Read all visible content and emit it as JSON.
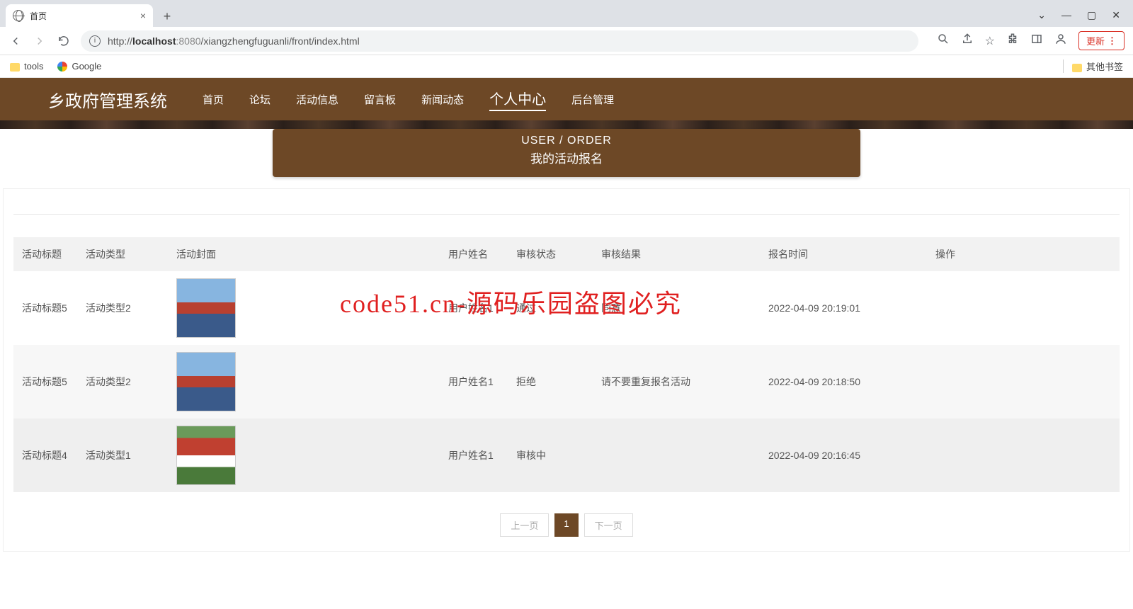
{
  "browser": {
    "tab_title": "首页",
    "url_prefix": "http://",
    "url_host": "localhost",
    "url_port": ":8080",
    "url_path": "/xiangzhengfuguanli/front/index.html",
    "bookmarks": {
      "tools": "tools",
      "google": "Google",
      "other": "其他书签"
    },
    "update": "更新"
  },
  "nav": {
    "logo": "乡政府管理系统",
    "items": [
      "首页",
      "论坛",
      "活动信息",
      "留言板",
      "新闻动态",
      "个人中心",
      "后台管理"
    ]
  },
  "header": {
    "line1": "USER / ORDER",
    "line2": "我的活动报名"
  },
  "table": {
    "cols": [
      "活动标题",
      "活动类型",
      "活动封面",
      "用户姓名",
      "审核状态",
      "审核结果",
      "报名时间",
      "操作"
    ],
    "rows": [
      {
        "title": "活动标题5",
        "type": "活动类型2",
        "user": "用户姓名1",
        "status": "通过",
        "result": "同意",
        "time": "2022-04-09 20:19:01",
        "img": "a"
      },
      {
        "title": "活动标题5",
        "type": "活动类型2",
        "user": "用户姓名1",
        "status": "拒绝",
        "result": "请不要重复报名活动",
        "time": "2022-04-09 20:18:50",
        "img": "a"
      },
      {
        "title": "活动标题4",
        "type": "活动类型1",
        "user": "用户姓名1",
        "status": "审核中",
        "result": "",
        "time": "2022-04-09 20:16:45",
        "img": "b"
      }
    ]
  },
  "pagination": {
    "prev": "上一页",
    "page": "1",
    "next": "下一页"
  },
  "watermark": "code51.cn-源码乐园盗图必究"
}
